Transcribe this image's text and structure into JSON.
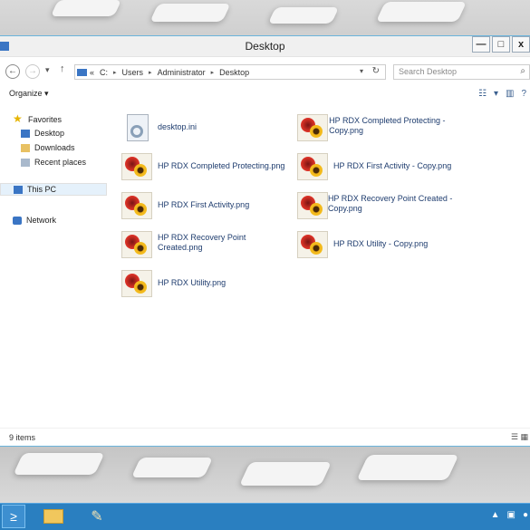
{
  "window": {
    "title": "Desktop",
    "controls": {
      "minimize": "—",
      "maximize": "□",
      "close": "x"
    }
  },
  "address_bar": {
    "back_icon": "back-arrow-icon",
    "forward_icon": "forward-arrow-icon",
    "up_icon": "up-arrow-icon",
    "overflow": "«",
    "path": [
      "C:",
      "Users",
      "Administrator",
      "Desktop"
    ],
    "separator": "▸",
    "dropdown": "▾",
    "refresh": "↻"
  },
  "search": {
    "placeholder": "Search Desktop",
    "icon": "search-icon"
  },
  "command_bar": {
    "organize_label": "Organize",
    "organize_arrow": "▾"
  },
  "nav_pane": {
    "favorites": "Favorites",
    "favorites_items": [
      "Desktop",
      "Downloads",
      "Recent places"
    ],
    "this_pc": "This PC",
    "network": "Network"
  },
  "files": [
    {
      "name": "desktop.ini",
      "type": "ini"
    },
    {
      "name": "HP RDX Completed Protecting - Copy.png",
      "type": "png"
    },
    {
      "name": "HP RDX Completed Protecting.png",
      "type": "png"
    },
    {
      "name": "HP RDX First Activity - Copy.png",
      "type": "png"
    },
    {
      "name": "HP RDX First Activity.png",
      "type": "png"
    },
    {
      "name": "HP RDX Recovery Point Created - Copy.png",
      "type": "png"
    },
    {
      "name": "HP RDX Recovery Point Created.png",
      "type": "png"
    },
    {
      "name": "HP RDX Utility - Copy.png",
      "type": "png"
    },
    {
      "name": "HP RDX Utility.png",
      "type": "png"
    }
  ],
  "status_bar": {
    "item_count": "9 items"
  },
  "colors": {
    "taskbar": "#2a7fc0",
    "accent": "#3a75c4",
    "file_text": "#1e3c6e"
  }
}
